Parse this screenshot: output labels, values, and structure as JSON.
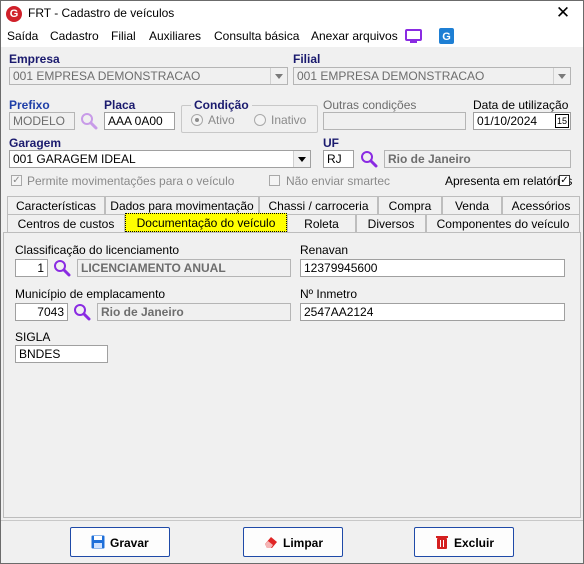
{
  "window": {
    "title": "FRT - Cadastro de veículos",
    "close": "✕",
    "logo": "G"
  },
  "menu": [
    "Saída",
    "Cadastro",
    "Filial",
    "Auxiliares",
    "Consulta básica",
    "Anexar arquivos"
  ],
  "empresa": {
    "label": "Empresa",
    "value": "001 EMPRESA DEMONSTRACAO"
  },
  "filial": {
    "label": "Filial",
    "value": "001 EMPRESA DEMONSTRACAO"
  },
  "prefixo": {
    "label": "Prefixo",
    "value": "MODELO"
  },
  "placa": {
    "label": "Placa",
    "value": "AAA 0A00"
  },
  "condicao": {
    "label": "Condição",
    "options": [
      "Ativo",
      "Inativo"
    ],
    "selected": "Ativo"
  },
  "outras_condicoes": {
    "label": "Outras condições",
    "value": ""
  },
  "data_utilizacao": {
    "label": "Data de utilização",
    "value": "01/10/2024",
    "cal": "15"
  },
  "garagem": {
    "label": "Garagem",
    "value": "001 GARAGEM IDEAL"
  },
  "uf": {
    "label": "UF",
    "value": "RJ",
    "name": "Rio de Janeiro"
  },
  "checks": {
    "permite": {
      "label": "Permite movimentações para o veículo",
      "checked": true
    },
    "nao_enviar": {
      "label": "Não enviar smartec",
      "checked": false
    },
    "apresenta": {
      "label": "Apresenta em relatórios",
      "checked": true
    }
  },
  "tabs_row1": [
    "Características",
    "Dados para movimentação",
    "Chassi / carroceria",
    "Compra",
    "Venda",
    "Acessórios"
  ],
  "tabs_row2": [
    "Centros de custos",
    "Documentação do veículo",
    "Roleta",
    "Diversos",
    "Componentes do veículo"
  ],
  "active_tab": "Documentação do veículo",
  "doc": {
    "classificacao": {
      "label": "Classificação do licenciamento",
      "code": "1",
      "name": "LICENCIAMENTO ANUAL"
    },
    "renavan": {
      "label": "Renavan",
      "value": "12379945600"
    },
    "municipio": {
      "label": "Município de emplacamento",
      "code": "7043",
      "name": "Rio de Janeiro"
    },
    "inmetro": {
      "label": "Nº Inmetro",
      "value": "2547AA2124"
    },
    "sigla": {
      "label": "SIGLA",
      "value": "BNDES"
    }
  },
  "buttons": {
    "gravar": "Gravar",
    "limpar": "Limpar",
    "excluir": "Excluir"
  },
  "colors": {
    "accent": "#1f3fa8",
    "active_tab": "#ffff00",
    "icon": "#8a2be2"
  }
}
